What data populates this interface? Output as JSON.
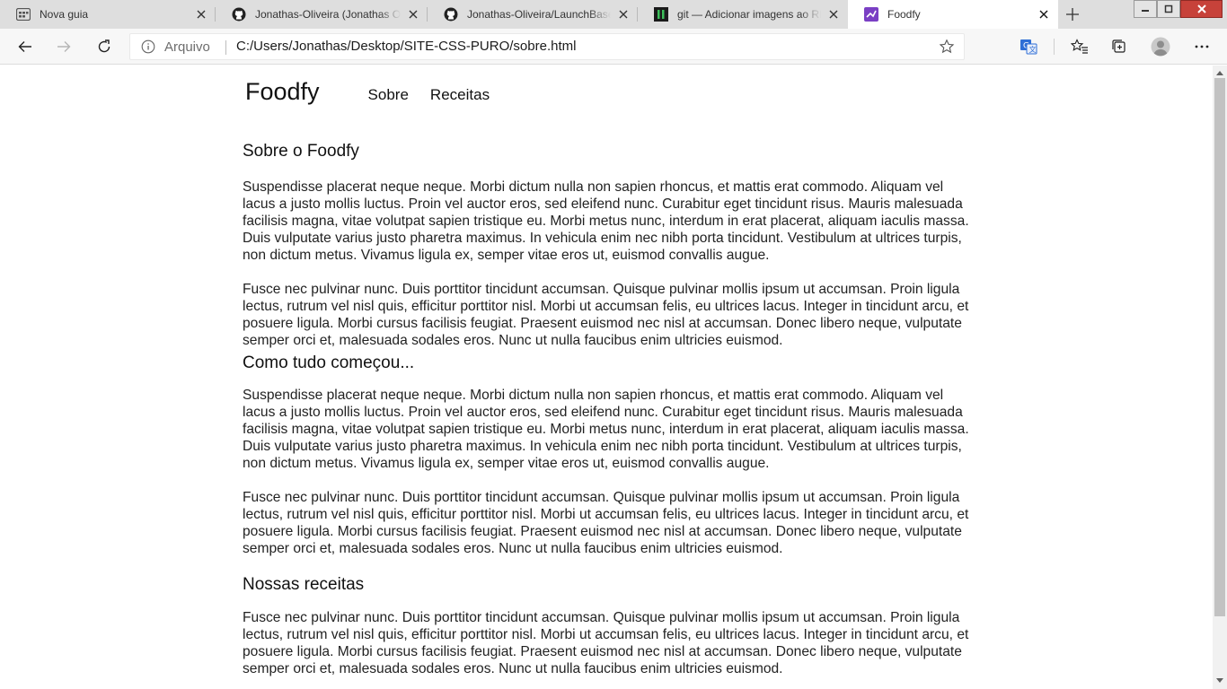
{
  "browser": {
    "tabs": [
      {
        "title": "Nova guia",
        "icon": "new-tab-page-icon"
      },
      {
        "title": "Jonathas-Oliveira (Jonathas Oliveira)",
        "icon": "github-icon"
      },
      {
        "title": "Jonathas-Oliveira/LaunchBase: Bootcamp",
        "icon": "github-icon"
      },
      {
        "title": "git — Adicionar imagens ao README.md",
        "icon": "stackoverflow-icon"
      },
      {
        "title": "Foodfy",
        "icon": "visual-studio-icon",
        "active": true
      }
    ],
    "address": {
      "site_label": "Arquivo",
      "url": "C:/Users/Jonathas/Desktop/SITE-CSS-PURO/sobre.html"
    }
  },
  "page": {
    "logo": "Foodfy",
    "nav": [
      "Sobre",
      "Receitas"
    ],
    "sections": [
      {
        "heading": "Sobre o Foodfy",
        "paragraphs": [
          "Suspendisse placerat neque neque. Morbi dictum nulla non sapien rhoncus, et mattis erat commodo. Aliquam vel lacus a justo mollis luctus. Proin vel auctor eros, sed eleifend nunc. Curabitur eget tincidunt risus. Mauris malesuada facilisis magna, vitae volutpat sapien tristique eu. Morbi metus nunc, interdum in erat placerat, aliquam iaculis massa. Duis vulputate varius justo pharetra maximus. In vehicula enim nec nibh porta tincidunt. Vestibulum at ultrices turpis, non dictum metus. Vivamus ligula ex, semper vitae eros ut, euismod convallis augue.",
          "Fusce nec pulvinar nunc. Duis porttitor tincidunt accumsan. Quisque pulvinar mollis ipsum ut accumsan. Proin ligula lectus, rutrum vel nisl quis, efficitur porttitor nisl. Morbi ut accumsan felis, eu ultrices lacus. Integer in tincidunt arcu, et posuere ligula. Morbi cursus facilisis feugiat. Praesent euismod nec nisl at accumsan. Donec libero neque, vulputate semper orci et, malesuada sodales eros. Nunc ut nulla faucibus enim ultricies euismod."
        ]
      },
      {
        "heading": "Como tudo começou...",
        "paragraphs": [
          "Suspendisse placerat neque neque. Morbi dictum nulla non sapien rhoncus, et mattis erat commodo. Aliquam vel lacus a justo mollis luctus. Proin vel auctor eros, sed eleifend nunc. Curabitur eget tincidunt risus. Mauris malesuada facilisis magna, vitae volutpat sapien tristique eu. Morbi metus nunc, interdum in erat placerat, aliquam iaculis massa. Duis vulputate varius justo pharetra maximus. In vehicula enim nec nibh porta tincidunt. Vestibulum at ultrices turpis, non dictum metus. Vivamus ligula ex, semper vitae eros ut, euismod convallis augue.",
          "Fusce nec pulvinar nunc. Duis porttitor tincidunt accumsan. Quisque pulvinar mollis ipsum ut accumsan. Proin ligula lectus, rutrum vel nisl quis, efficitur porttitor nisl. Morbi ut accumsan felis, eu ultrices lacus. Integer in tincidunt arcu, et posuere ligula. Morbi cursus facilisis feugiat. Praesent euismod nec nisl at accumsan. Donec libero neque, vulputate semper orci et, malesuada sodales eros. Nunc ut nulla faucibus enim ultricies euismod."
        ]
      },
      {
        "heading": "Nossas receitas",
        "paragraphs": [
          "Fusce nec pulvinar nunc. Duis porttitor tincidunt accumsan. Quisque pulvinar mollis ipsum ut accumsan. Proin ligula lectus, rutrum vel nisl quis, efficitur porttitor nisl. Morbi ut accumsan felis, eu ultrices lacus. Integer in tincidunt arcu, et posuere ligula. Morbi cursus facilisis feugiat. Praesent euismod nec nisl at accumsan. Donec libero neque, vulputate semper orci et, malesuada sodales eros. Nunc ut nulla faucibus enim ultricies euismod."
        ]
      }
    ]
  },
  "colors": {
    "tabstrip": "#dedede",
    "window_close": "#c7423a",
    "translate_icon": "#2f6fd6"
  }
}
